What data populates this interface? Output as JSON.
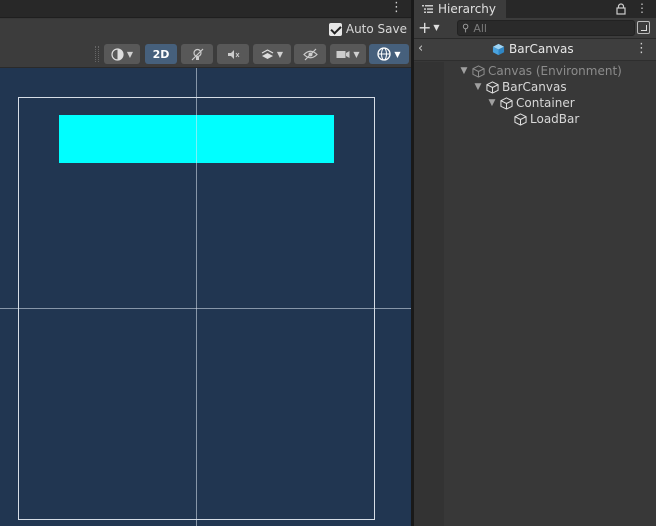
{
  "scene": {
    "menu_icon": "kebab-menu-icon",
    "autosave_label": "Auto Save",
    "autosave_checked": true,
    "toolbar": {
      "two_d_label": "2D",
      "buttons": [
        "draw-mode-icon",
        "lighting-icon",
        "audio-icon",
        "effects-icon",
        "visibility-icon",
        "camera-icon",
        "gizmos-icon"
      ]
    },
    "colors": {
      "background": "#213651",
      "loadbar": "#00ffff"
    }
  },
  "hierarchy": {
    "tab_label": "Hierarchy",
    "search_placeholder": "All",
    "breadcrumb_title": "BarCanvas",
    "items": [
      {
        "label": "Canvas (Environment)",
        "dimmed": true
      },
      {
        "label": "BarCanvas",
        "dimmed": false
      },
      {
        "label": "Container",
        "dimmed": false
      },
      {
        "label": "LoadBar",
        "dimmed": false
      }
    ]
  }
}
